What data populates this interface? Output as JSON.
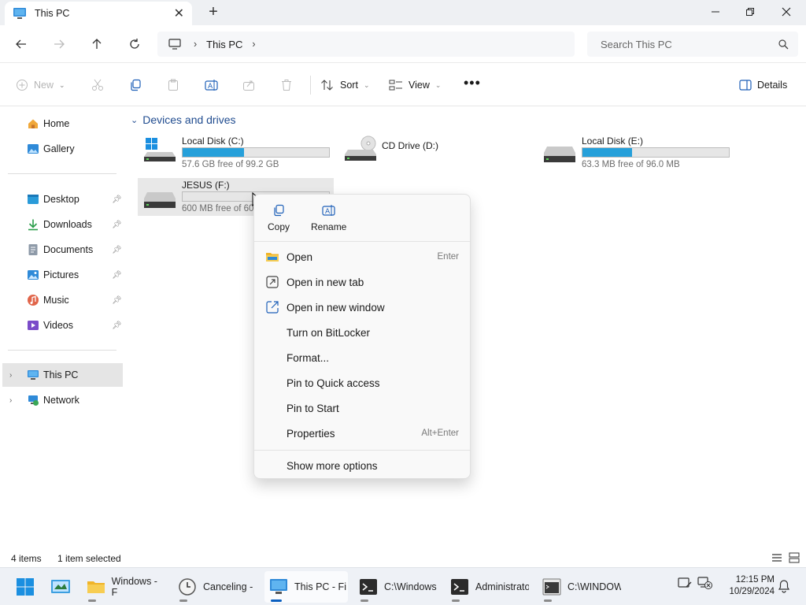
{
  "window": {
    "tab_title": "This PC",
    "controls": {
      "minimize": "minimize",
      "maximize": "maximize",
      "close": "close"
    }
  },
  "address": {
    "breadcrumb": [
      "This PC"
    ],
    "search_placeholder": "Search This PC"
  },
  "toolbar": {
    "new_label": "New",
    "sort_label": "Sort",
    "view_label": "View",
    "details_label": "Details"
  },
  "sidebar": {
    "items": [
      {
        "label": "Home",
        "icon": "home-icon"
      },
      {
        "label": "Gallery",
        "icon": "gallery-icon"
      },
      {
        "label": "Desktop",
        "icon": "desktop-icon",
        "pinned": true
      },
      {
        "label": "Downloads",
        "icon": "downloads-icon",
        "pinned": true
      },
      {
        "label": "Documents",
        "icon": "documents-icon",
        "pinned": true
      },
      {
        "label": "Pictures",
        "icon": "pictures-icon",
        "pinned": true
      },
      {
        "label": "Music",
        "icon": "music-icon",
        "pinned": true
      },
      {
        "label": "Videos",
        "icon": "videos-icon",
        "pinned": true
      },
      {
        "label": "This PC",
        "icon": "this-pc-icon",
        "selected": true
      },
      {
        "label": "Network",
        "icon": "network-icon"
      }
    ]
  },
  "main": {
    "section_title": "Devices and drives",
    "drives": [
      {
        "name": "Local Disk (C:)",
        "free": "57.6 GB free of 99.2 GB",
        "used_fraction": 0.42
      },
      {
        "name": "CD Drive (D:)"
      },
      {
        "name": "Local Disk (E:)",
        "free": "63.3 MB free of 96.0 MB",
        "used_fraction": 0.34
      },
      {
        "name": "JESUS (F:)",
        "free": "600 MB free of 60",
        "used_fraction": 0.0
      }
    ]
  },
  "context_menu": {
    "top_actions": [
      {
        "label": "Copy",
        "icon": "copy-icon"
      },
      {
        "label": "Rename",
        "icon": "rename-icon"
      }
    ],
    "items": [
      {
        "label": "Open",
        "shortcut": "Enter"
      },
      {
        "label": "Open in new tab",
        "shortcut": ""
      },
      {
        "label": "Open in new window",
        "shortcut": ""
      },
      {
        "label": "Turn on BitLocker",
        "shortcut": ""
      },
      {
        "label": "Format...",
        "shortcut": ""
      },
      {
        "label": "Pin to Quick access",
        "shortcut": ""
      },
      {
        "label": "Pin to Start",
        "shortcut": ""
      },
      {
        "label": "Properties",
        "shortcut": "Alt+Enter"
      }
    ],
    "more_options": "Show more options"
  },
  "status": {
    "items_count": "4 items",
    "selected": "1 item selected"
  },
  "taskbar": {
    "tasks": [
      {
        "label": "Windows - F",
        "icon": "folder-icon"
      },
      {
        "label": "Canceling -",
        "icon": "clock-icon"
      },
      {
        "label": "This PC - Fi",
        "icon": "this-pc-icon"
      },
      {
        "label": "C:\\Windows",
        "icon": "terminal-icon"
      },
      {
        "label": "Administrato",
        "icon": "terminal-icon"
      },
      {
        "label": "C:\\WINDOW",
        "icon": "cmd-icon"
      }
    ],
    "time": "12:15 PM",
    "date": "10/29/2024"
  },
  "colors": {
    "accent": "#0a5fc0",
    "drive_bar": "#26a0da",
    "section_title": "#1f4b8f"
  }
}
